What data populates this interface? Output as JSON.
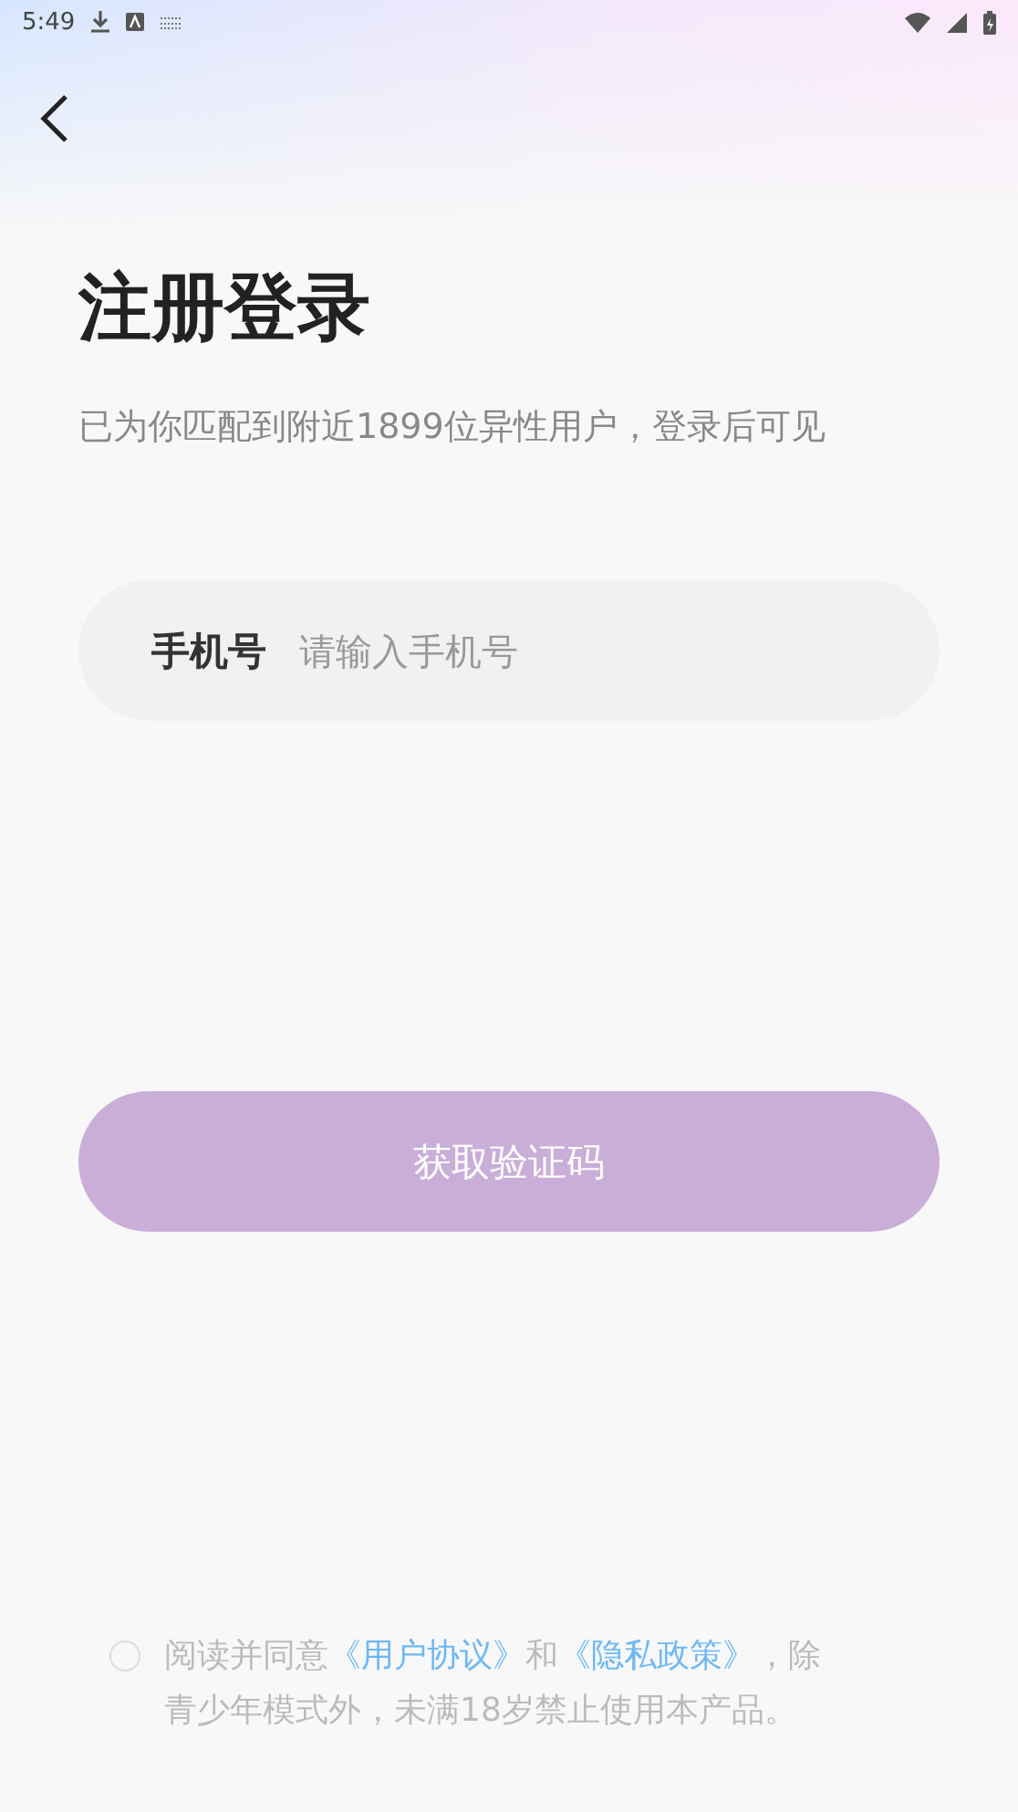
{
  "status_bar": {
    "time": "5:49"
  },
  "title": "注册登录",
  "subtitle": "已为你匹配到附近1899位异性用户，登录后可见",
  "phone_field": {
    "label": "手机号",
    "placeholder": "请输入手机号"
  },
  "submit_button": {
    "label": "获取验证码",
    "disabled": true
  },
  "agreement": {
    "checked": false,
    "parts": [
      {
        "kind": "text",
        "text": "阅读并同意"
      },
      {
        "kind": "link",
        "text": "《用户协议》"
      },
      {
        "kind": "text",
        "text": "和"
      },
      {
        "kind": "link",
        "text": "《隐私政策》"
      },
      {
        "kind": "text",
        "text": "，除青少年模式外，未满18岁禁止使用本产品。"
      }
    ]
  }
}
